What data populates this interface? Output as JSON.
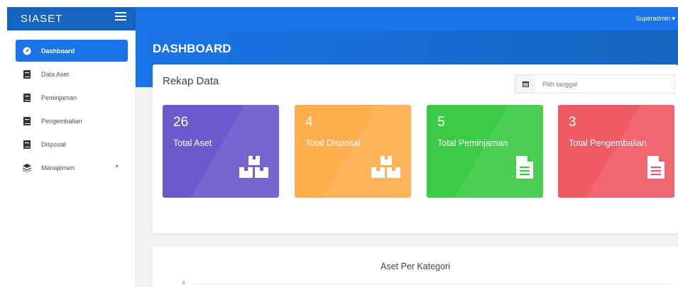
{
  "brand": "SIASET",
  "user": "Superadmin",
  "sidebar": {
    "items": [
      {
        "label": "Dashboard",
        "icon": "tachometer-icon"
      },
      {
        "label": "Data Aset",
        "icon": "book-icon"
      },
      {
        "label": "Peminjaman",
        "icon": "book-icon"
      },
      {
        "label": "Pengembalian",
        "icon": "book-icon"
      },
      {
        "label": "Disposal",
        "icon": "book-icon"
      },
      {
        "label": "Manajemen",
        "icon": "layers-icon"
      }
    ]
  },
  "page_title": "DASHBOARD",
  "rekap": {
    "title": "Rekap Data",
    "date_placeholder": "Pilih tanggal"
  },
  "stats": [
    {
      "value": "26",
      "label": "Total Aset",
      "color": "#6a5acd",
      "icon": "cubes-icon"
    },
    {
      "value": "4",
      "label": "Total Disposal",
      "color": "#ffad4d",
      "icon": "cubes-icon"
    },
    {
      "value": "5",
      "label": "Total Peminjaman",
      "color": "#3bcb46",
      "icon": "document-icon"
    },
    {
      "value": "3",
      "label": "Total Pengembalian",
      "color": "#f05a64",
      "icon": "document-icon"
    }
  ],
  "chart": {
    "title": "Aset Per Kategori",
    "y_tick_top": "8"
  },
  "colors": {
    "primary": "#1a73e8",
    "primary_dark": "#1565c0"
  }
}
